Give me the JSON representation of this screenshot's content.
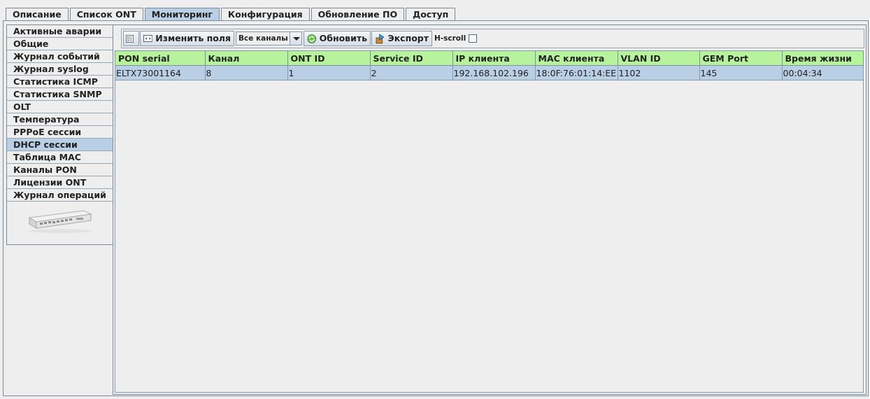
{
  "top_tabs": [
    {
      "label": "Описание"
    },
    {
      "label": "Список ONT"
    },
    {
      "label": "Мониторинг"
    },
    {
      "label": "Конфигурация"
    },
    {
      "label": "Обновление ПО"
    },
    {
      "label": "Доступ"
    }
  ],
  "active_tab": "Мониторинг",
  "sidebar": {
    "items": [
      {
        "label": "Активные аварии"
      },
      {
        "label": "Общие"
      },
      {
        "label": "Журнал событий"
      },
      {
        "label": "Журнал syslog"
      },
      {
        "label": "Статистика ICMP"
      },
      {
        "label": "Статистика SNMP"
      },
      {
        "label": "OLT"
      },
      {
        "label": "Температура"
      },
      {
        "label": "PPPoE сессии"
      },
      {
        "label": "DHCP сессии"
      },
      {
        "label": "Таблица MAC"
      },
      {
        "label": "Каналы PON"
      },
      {
        "label": "Лицензии ONT"
      },
      {
        "label": "Журнал операций"
      }
    ],
    "active": "DHCP сессии",
    "device_image": "olt-device-icon"
  },
  "toolbar": {
    "edit_fields_label": "Изменить поля",
    "channel_select_value": "Все каналы",
    "refresh_label": "Обновить",
    "export_label": "Экспорт",
    "hscroll_label": "H-scroll",
    "hscroll_checked": false
  },
  "table": {
    "columns": [
      "PON serial",
      "Канал",
      "ONT ID",
      "Service ID",
      "IP клиента",
      "MAC клиента",
      "VLAN ID",
      "GEM Port",
      "Время жизни"
    ],
    "rows": [
      [
        "ELTX73001164",
        "8",
        "1",
        "2",
        "192.168.102.196",
        "18:0F:76:01:14:EE",
        "1102",
        "145",
        "00:04:34"
      ]
    ]
  },
  "colors": {
    "header_bg": "#b6f39c",
    "selected_bg": "#b8cfe5",
    "window_bg": "#eeeeee"
  }
}
